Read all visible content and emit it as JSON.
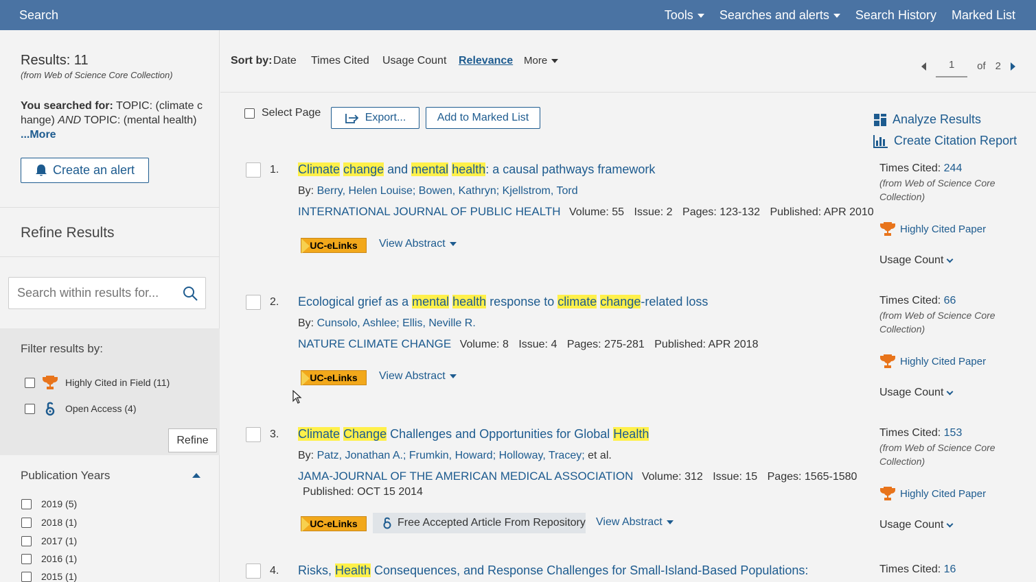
{
  "topbar": {
    "brand": "Search",
    "nav": [
      "Tools",
      "Searches and alerts",
      "Search History",
      "Marked List"
    ]
  },
  "sidebar": {
    "results_label": "Results: 11",
    "results_source": "(from Web of Science Core Collection)",
    "searched_prefix": "You searched for:",
    "searched_q1_field": "TOPIC:",
    "searched_q1_val": "(climate c hange)",
    "searched_op": "AND",
    "searched_q2_field": "TOPIC:",
    "searched_q2_val": "(mental health)",
    "more": "...More",
    "create_alert": "Create an alert",
    "refine_title": "Refine Results",
    "search_placeholder": "Search within results for...",
    "filter_title": "Filter results by:",
    "filters": [
      {
        "label": "Highly Cited in Field (11)",
        "icon": "trophy-icon"
      },
      {
        "label": "Open Access (4)",
        "icon": "open-access-icon"
      }
    ],
    "refine_button": "Refine",
    "pub_years_title": "Publication Years",
    "years": [
      "2019 (5)",
      "2018 (1)",
      "2017 (1)",
      "2016 (1)",
      "2015 (1)"
    ]
  },
  "sortbar": {
    "label": "Sort by:",
    "options": [
      "Date",
      "Times Cited",
      "Usage Count",
      "Relevance",
      "More"
    ],
    "active": "Relevance",
    "page": "1",
    "of": "of",
    "total_pages": "2"
  },
  "toolbar": {
    "select_page": "Select Page",
    "export": "Export...",
    "add_marked": "Add to Marked List",
    "analyze": "Analyze Results",
    "citation_report": "Create Citation Report"
  },
  "records": [
    {
      "num": "1.",
      "title_parts": [
        [
          "Climate",
          true
        ],
        [
          " ",
          false
        ],
        [
          "change",
          true
        ],
        [
          " and ",
          false
        ],
        [
          "mental",
          true
        ],
        [
          " ",
          false
        ],
        [
          "health",
          true
        ],
        [
          ": a causal pathways framework",
          false
        ]
      ],
      "by": "By:",
      "authors": "Berry, Helen Louise; Bowen, Kathryn; Kjellstrom, Tord",
      "journal": "INTERNATIONAL JOURNAL OF PUBLIC HEALTH",
      "volume": "55",
      "issue": "2",
      "pages": "123-132",
      "published": "APR 2010",
      "times_cited": "244",
      "tc_note": "(from Web of Science Core Collection)",
      "highly_cited": "Highly Cited Paper",
      "usage": "Usage Count",
      "uc_elinks": "UC-eLinks",
      "view_abstract": "View Abstract"
    },
    {
      "num": "2.",
      "title_parts": [
        [
          "Ecological grief as a ",
          false
        ],
        [
          "mental",
          true
        ],
        [
          " ",
          false
        ],
        [
          "health",
          true
        ],
        [
          " response to ",
          false
        ],
        [
          "climate",
          true
        ],
        [
          " ",
          false
        ],
        [
          "change",
          true
        ],
        [
          "-related loss",
          false
        ]
      ],
      "by": "By:",
      "authors": "Cunsolo, Ashlee; Ellis, Neville R.",
      "journal": "NATURE CLIMATE CHANGE",
      "volume": "8",
      "issue": "4",
      "pages": "275-281",
      "published": "APR 2018",
      "times_cited": "66",
      "tc_note": "(from Web of Science Core Collection)",
      "highly_cited": "Highly Cited Paper",
      "usage": "Usage Count",
      "uc_elinks": "UC-eLinks",
      "view_abstract": "View Abstract"
    },
    {
      "num": "3.",
      "title_parts": [
        [
          "Climate",
          true
        ],
        [
          " ",
          false
        ],
        [
          "Change",
          true
        ],
        [
          " Challenges and Opportunities for Global ",
          false
        ],
        [
          "Health",
          true
        ]
      ],
      "by": "By:",
      "authors": "Patz, Jonathan A.; Frumkin, Howard; Holloway, Tracey;",
      "etal": "et al.",
      "journal": "JAMA-JOURNAL OF THE AMERICAN MEDICAL ASSOCIATION",
      "volume": "312",
      "issue": "15",
      "pages": "1565-1580",
      "published": "OCT 15 2014",
      "times_cited": "153",
      "tc_note": "(from Web of Science Core Collection)",
      "highly_cited": "Highly Cited Paper",
      "usage": "Usage Count",
      "uc_elinks": "UC-eLinks",
      "free_article": "Free Accepted Article From Repository",
      "view_abstract": "View Abstract"
    },
    {
      "num": "4.",
      "title_parts": [
        [
          "Risks, ",
          false
        ],
        [
          "Health",
          true
        ],
        [
          " Consequences, and Response Challenges for Small-Island-Based Populations:",
          false
        ]
      ],
      "times_cited": "16"
    }
  ],
  "labels": {
    "volume": "Volume:",
    "issue": "Issue:",
    "pages": "Pages:",
    "published": "Published:",
    "times_cited": "Times Cited:"
  },
  "colors": {
    "topbar": "#4a73a3",
    "link": "#1d5b8f",
    "highlight": "#fff04a",
    "uc_elinks": "#f2a81b"
  }
}
